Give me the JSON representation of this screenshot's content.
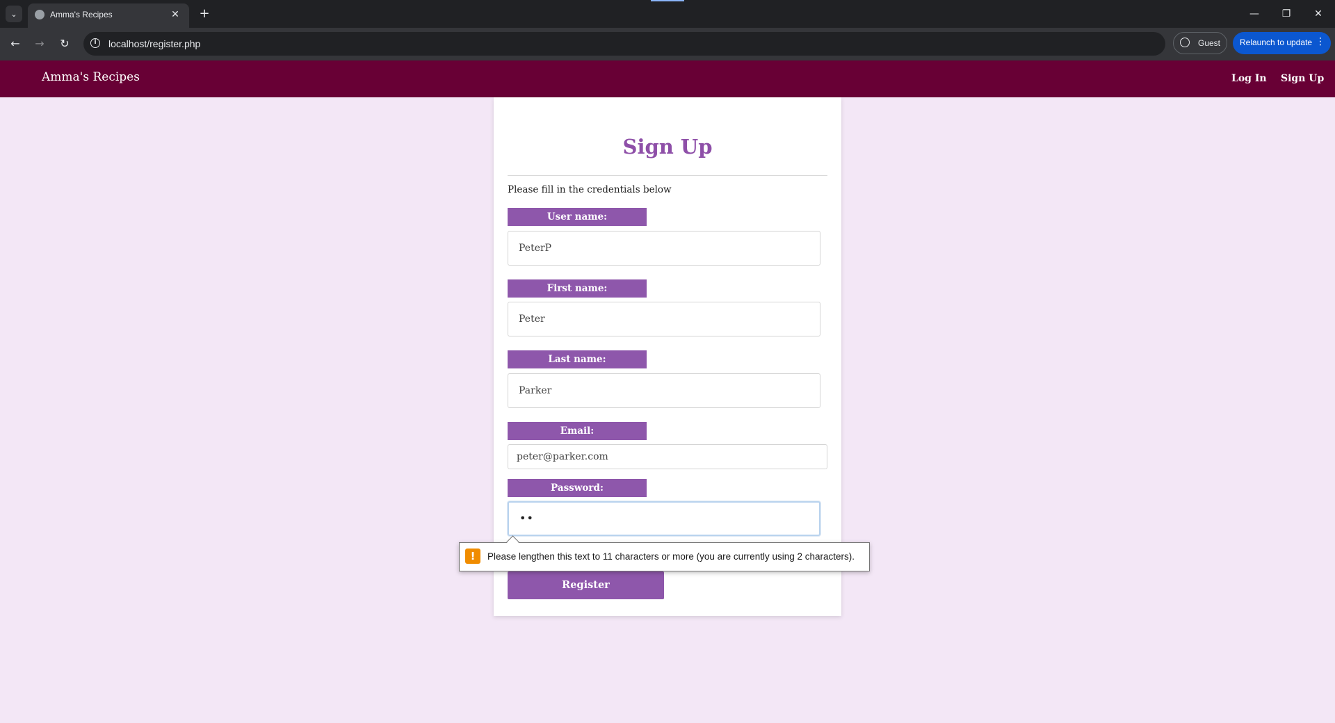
{
  "browser": {
    "tab_title": "Amma's Recipes",
    "tab_close": "✕",
    "new_tab": "+",
    "url": "localhost/register.php",
    "guest_label": "Guest",
    "relaunch_label": "Relaunch to update",
    "icons": {
      "dropdown": "⌄",
      "back": "←",
      "forward": "→",
      "reload": "↻",
      "minimize": "—",
      "restore": "❐",
      "close": "✕",
      "more": "⋮",
      "info": "i"
    }
  },
  "site_nav": {
    "brand": "Amma's Recipes",
    "login": "Log In",
    "signup": "Sign Up",
    "bg_color": "#680035"
  },
  "form": {
    "title": "Sign Up",
    "subtitle": "Please fill in the credentials below",
    "fields": [
      {
        "label": "User name:",
        "value": "PeterP"
      },
      {
        "label": "First name:",
        "value": "Peter"
      },
      {
        "label": "Last name:",
        "value": "Parker"
      },
      {
        "label": "Email:",
        "value": "peter@parker.com"
      },
      {
        "label": "Password:",
        "value": "••"
      }
    ],
    "submit_label": "Register",
    "accent_color": "#8e57ab"
  },
  "validation": {
    "icon": "!",
    "message": "Please lengthen this text to 11 characters or more (you are currently using 2 characters)."
  }
}
